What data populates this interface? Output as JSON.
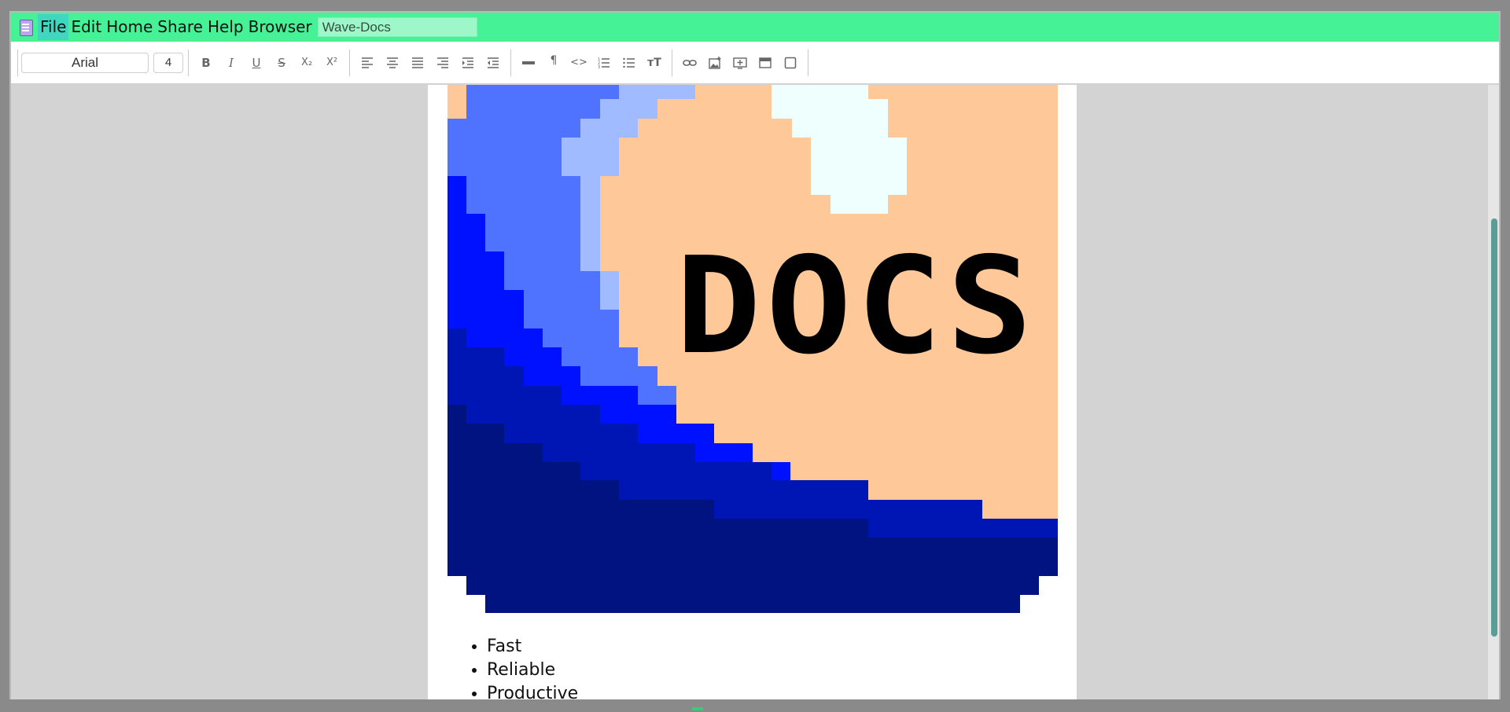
{
  "menubar": {
    "items": [
      "File",
      "Edit",
      "Home",
      "Share",
      "Help",
      "Browser"
    ],
    "document_title_value": "Wave-Docs"
  },
  "toolbar": {
    "font_family": "Arial",
    "font_size": "4",
    "buttons": [
      {
        "name": "bold-icon",
        "glyph": "B"
      },
      {
        "name": "italic-icon",
        "glyph": "I"
      },
      {
        "name": "underline-icon",
        "glyph": "U"
      },
      {
        "name": "strikethrough-icon",
        "glyph": "S"
      },
      {
        "name": "subscript-icon",
        "glyph": "X₂"
      },
      {
        "name": "superscript-icon",
        "glyph": "X²"
      },
      {
        "name": "align-left-icon"
      },
      {
        "name": "align-center-icon"
      },
      {
        "name": "align-justify-icon"
      },
      {
        "name": "align-right-icon"
      },
      {
        "name": "indent-icon"
      },
      {
        "name": "outdent-icon"
      },
      {
        "name": "horizontal-rule-icon"
      },
      {
        "name": "paragraph-icon",
        "glyph": "¶"
      },
      {
        "name": "code-icon",
        "glyph": "<>"
      },
      {
        "name": "ordered-list-icon"
      },
      {
        "name": "unordered-list-icon"
      },
      {
        "name": "text-size-icon",
        "glyph": "тT"
      },
      {
        "name": "link-icon"
      },
      {
        "name": "insert-image-icon"
      },
      {
        "name": "insert-embed-icon"
      },
      {
        "name": "insert-frame-icon"
      },
      {
        "name": "insert-box-icon"
      }
    ]
  },
  "document": {
    "logo_text": "DOCS",
    "list_items": [
      "Fast",
      "Reliable",
      "Productive"
    ]
  },
  "colors": {
    "menubar_bg": "#46f296",
    "logo_peach": "#fec898",
    "logo_navy": "#001380",
    "logo_darkblue": "#0016b4",
    "logo_blue": "#0011ff",
    "logo_mid": "#4f72ff",
    "logo_light": "#a0bbff",
    "logo_cloud": "#eefffe",
    "scroll_thumb": "#5b9b98"
  }
}
